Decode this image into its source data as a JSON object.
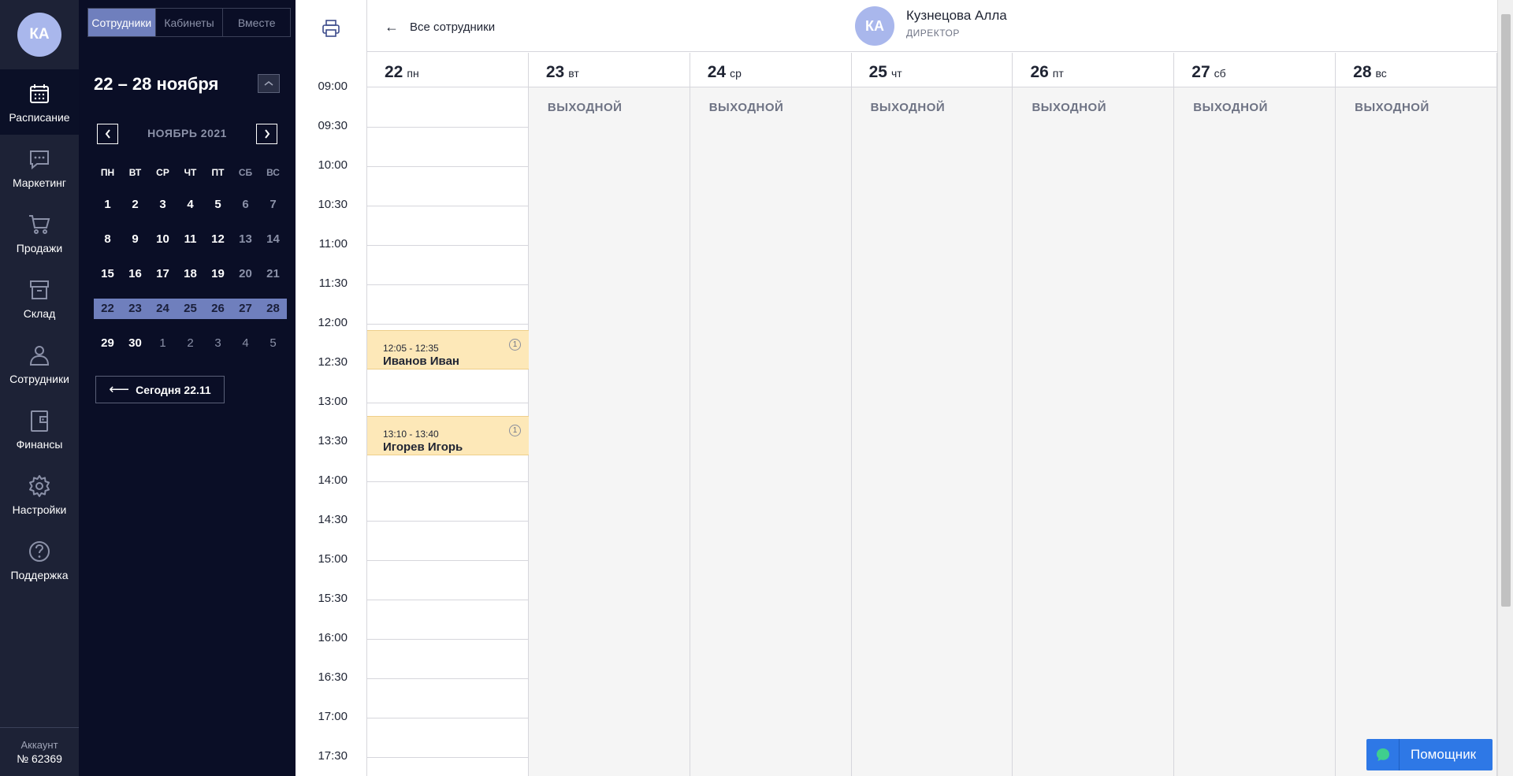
{
  "nav": {
    "avatar_initials": "КА",
    "items": [
      {
        "label": "Расписание",
        "icon": "calendar-icon",
        "active": true
      },
      {
        "label": "Маркетинг",
        "icon": "chat-icon"
      },
      {
        "label": "Продажи",
        "icon": "cart-icon"
      },
      {
        "label": "Склад",
        "icon": "box-icon"
      },
      {
        "label": "Сотрудники",
        "icon": "person-icon"
      },
      {
        "label": "Финансы",
        "icon": "wallet-icon"
      },
      {
        "label": "Настройки",
        "icon": "gear-icon"
      },
      {
        "label": "Поддержка",
        "icon": "question-icon"
      }
    ],
    "account_label": "Аккаунт",
    "account_number": "№ 62369"
  },
  "panel": {
    "tabs": [
      "Сотрудники",
      "Кабинеты",
      "Вместе"
    ],
    "active_tab": "Сотрудники",
    "range_title": "22 – 28 ноября",
    "month_label": "НОЯБРЬ 2021",
    "weekdays": [
      "ПН",
      "ВТ",
      "СР",
      "ЧТ",
      "ПТ",
      "СБ",
      "ВС"
    ],
    "weeks": [
      [
        "1",
        "2",
        "3",
        "4",
        "5",
        "6",
        "7"
      ],
      [
        "8",
        "9",
        "10",
        "11",
        "12",
        "13",
        "14"
      ],
      [
        "15",
        "16",
        "17",
        "18",
        "19",
        "20",
        "21"
      ],
      [
        "22",
        "23",
        "24",
        "25",
        "26",
        "27",
        "28"
      ],
      [
        "29",
        "30",
        "1",
        "2",
        "3",
        "4",
        "5"
      ]
    ],
    "selected_week_index": 3,
    "today_button": "Сегодня 22.11"
  },
  "header": {
    "back_label": "Все сотрудники",
    "employee_initials": "КА",
    "employee_name": "Кузнецова Алла",
    "employee_role": "ДИРЕКТОР"
  },
  "days": [
    {
      "num": "22",
      "wd": "пн",
      "off": false
    },
    {
      "num": "23",
      "wd": "вт",
      "off": true
    },
    {
      "num": "24",
      "wd": "ср",
      "off": true
    },
    {
      "num": "25",
      "wd": "чт",
      "off": true
    },
    {
      "num": "26",
      "wd": "пт",
      "off": true
    },
    {
      "num": "27",
      "wd": "сб",
      "off": true
    },
    {
      "num": "28",
      "wd": "вс",
      "off": true
    }
  ],
  "day_off_label": "ВЫХОДНОЙ",
  "times": [
    "09:00",
    "09:30",
    "10:00",
    "10:30",
    "11:00",
    "11:30",
    "12:00",
    "12:30",
    "13:00",
    "13:30",
    "14:00",
    "14:30",
    "15:00",
    "15:30",
    "16:00",
    "16:30",
    "17:00",
    "17:30"
  ],
  "appointments": [
    {
      "time": "12:05 - 12:35",
      "client": "Иванов Иван",
      "start": "12:05",
      "end": "12:35",
      "day_index": 0,
      "badge": "1"
    },
    {
      "time": "13:10 - 13:40",
      "client": "Игорев Игорь",
      "start": "13:10",
      "end": "13:40",
      "day_index": 0,
      "badge": "1"
    }
  ],
  "helper_label": "Помощник",
  "colors": {
    "nav_bg": "#1d2236",
    "panel_bg": "#0a0e26",
    "accent": "#6f7fbd",
    "avatar": "#a9b7ec",
    "appointment": "#fde8b8",
    "helper": "#2e78e6",
    "day_off_bg": "#f5f5f5"
  }
}
